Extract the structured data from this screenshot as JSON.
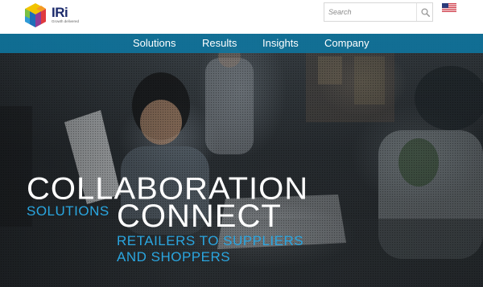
{
  "brand": {
    "name": "IRi",
    "tagline": "Growth delivered",
    "colors": {
      "navy": "#1b2a6b",
      "accent": "#2aa6e0",
      "nav": "#0e76a0"
    }
  },
  "search": {
    "placeholder": "Search",
    "icon": "search-icon"
  },
  "locale": {
    "flag": "us-flag-icon"
  },
  "nav": {
    "items": [
      "Solutions",
      "Results",
      "Insights",
      "Company"
    ]
  },
  "hero": {
    "line1": "COLLABORATION",
    "tag": "SOLUTIONS",
    "line2": "CONNECT",
    "sub1": "RETAILERS TO SUPPLIERS",
    "sub2": "AND SHOPPERS"
  }
}
